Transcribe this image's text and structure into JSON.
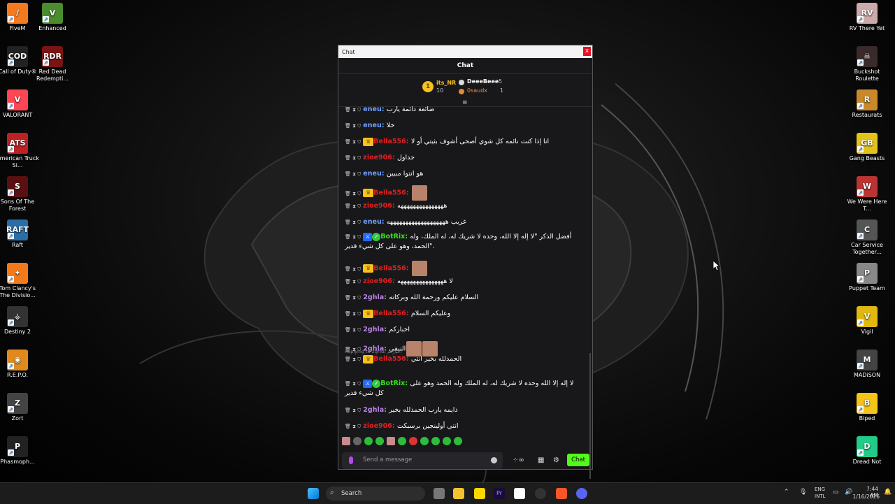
{
  "desktop_left": [
    {
      "label": "FiveM",
      "color": "#f47a20",
      "glyph": "/"
    },
    {
      "label": "Call of Duty®",
      "color": "#222",
      "glyph": "COD"
    },
    {
      "label": "VALORANT",
      "color": "#ff4655",
      "glyph": "V"
    },
    {
      "label": "American Truck Si...",
      "color": "#b22",
      "glyph": "ATS"
    },
    {
      "label": "Sons Of The Forest",
      "color": "#5a1010",
      "glyph": "S"
    },
    {
      "label": "Raft",
      "color": "#2b6ea6",
      "glyph": "RAFT"
    },
    {
      "label": "Tom Clancy's The Divisio...",
      "color": "#f27a1a",
      "glyph": "✦"
    },
    {
      "label": "Destiny 2",
      "color": "#333",
      "glyph": "⚶"
    },
    {
      "label": "R.E.P.O.",
      "color": "#e08a1e",
      "glyph": "◉"
    },
    {
      "label": "Zort",
      "color": "#444",
      "glyph": "Z"
    },
    {
      "label": "Phasmoph...",
      "color": "#222",
      "glyph": "P"
    }
  ],
  "desktop_left2": [
    {
      "label": "Enhanced",
      "color": "#4b8c2e",
      "glyph": "V"
    },
    {
      "label": "Red Dead Redempti...",
      "color": "#7a1414",
      "glyph": "RDR"
    }
  ],
  "desktop_right": [
    {
      "label": "RV There Yet",
      "color": "#caa",
      "glyph": "RV"
    },
    {
      "label": "Buckshot Roulette",
      "color": "#3a2a2a",
      "glyph": "☠"
    },
    {
      "label": "Restaurats",
      "color": "#c9892a",
      "glyph": "R"
    },
    {
      "label": "Gang Beasts",
      "color": "#e3c21a",
      "glyph": "GB"
    },
    {
      "label": "We Were Here T...",
      "color": "#b33",
      "glyph": "W"
    },
    {
      "label": "Car Service Together...",
      "color": "#555",
      "glyph": "C"
    },
    {
      "label": "Puppet Team",
      "color": "#888",
      "glyph": "P"
    },
    {
      "label": "Vigil",
      "color": "#e0b80f",
      "glyph": "V"
    },
    {
      "label": "MADiSON",
      "color": "#444",
      "glyph": "M"
    },
    {
      "label": "Biped",
      "color": "#f4c518",
      "glyph": "B"
    },
    {
      "label": "Dread Not",
      "color": "#2c8",
      "glyph": "D"
    }
  ],
  "chat_window": {
    "title": "Chat",
    "close": "x",
    "header": "Chat",
    "leaderboard": {
      "rank": "1",
      "first": {
        "name": "its_NR",
        "count": "10"
      },
      "second": {
        "name": "DeeeBeee",
        "count": "5"
      },
      "third": {
        "name": "0saudx",
        "count": "1"
      }
    },
    "messages": [
      {
        "tools": "🗑 ⧗ ⛉",
        "user": "eneu",
        "color": "blue",
        "text": "ضائعة دائمة يارب",
        "badges": ""
      },
      {
        "tools": "🗑 ⧗ ⛉",
        "user": "eneu",
        "color": "blue",
        "text": "خلا",
        "badges": ""
      },
      {
        "tools": "🗑 ⧗ ⛉",
        "user": "Bella556",
        "color": "red",
        "text": "انا إذا كنت نائمه كل شوي أصحى أشوف بثيتي أو لا",
        "badges": "crown"
      },
      {
        "tools": "🗑 ⧗ ⛉",
        "user": "zioe906",
        "color": "red",
        "text": "جداول",
        "badges": ""
      },
      {
        "tools": "🗑 ⧗ ⛉",
        "user": "eneu",
        "color": "blue",
        "text": "هو انتوا مبيين",
        "badges": ""
      },
      {
        "tools": "🗑 ⧗ ⛉",
        "user": "Bella556",
        "color": "red",
        "text": "",
        "badges": "crown",
        "emote": "1"
      },
      {
        "tools": "🗑 ⧗ ⛉",
        "user": "zioe906",
        "color": "red",
        "text": "هههههههههههههههه",
        "badges": ""
      },
      {
        "tools": "🗑 ⧗ ⛉",
        "user": "eneu",
        "color": "blue",
        "text": "غريب هههههههههههههههههههه",
        "badges": ""
      },
      {
        "tools": "🗑 ⧗ ⛉",
        "user": "BotRix",
        "color": "green",
        "text": "أفضل الذكر \"لا إله إلا الله، وحده لا شريك له، له الملك، وله الحمد، وهو على كل شيء قدير\".",
        "badges": "mod"
      },
      {
        "tools": "🗑 ⧗ ⛉",
        "user": "Bella556",
        "color": "red",
        "text": "",
        "badges": "crown",
        "emote": "1"
      },
      {
        "tools": "🗑 ⧗ ⛉",
        "user": "zioe906",
        "color": "red",
        "text": "لا هههههههههههههههه",
        "badges": ""
      },
      {
        "tools": "🗑 ⧗ ⛉",
        "user": "2ghla",
        "color": "purple",
        "text": "السلام عليكم ورحمة الله وبركاته",
        "badges": ""
      },
      {
        "tools": "🗑 ⧗ ⛉",
        "user": "Bella556",
        "color": "red",
        "text": "وعليكم السلام",
        "badges": "crown"
      },
      {
        "tools": "🗑 ⧗ ⛉",
        "user": "2ghla",
        "color": "purple",
        "text": "اخباركم",
        "badges": ""
      },
      {
        "tools": "🗑 ⧗ ⛉",
        "user": "2ghla",
        "color": "purple",
        "text": "النبقى",
        "badges": "",
        "emote": "2"
      },
      {
        "tools": "🗑 ⧗ ⛉",
        "user": "Bella556",
        "color": "red",
        "text": "الحمدلله بخير انتي",
        "badges": "crown",
        "reply": "Replying to 2ghla: اخباركم"
      },
      {
        "tools": "🗑 ⧗ ⛉",
        "user": "BotRix",
        "color": "green",
        "text": "لا إله إلا الله وحده لا شريك له، له الملك وله الحمد وهو على كل شيء قدير",
        "badges": "mod"
      },
      {
        "tools": "🗑 ⧗ ⛉",
        "user": "2ghla",
        "color": "purple",
        "text": "دايمه يارب الحمدلله بخير",
        "badges": ""
      },
      {
        "tools": "🗑 ⧗ ⛉",
        "user": "zioe906",
        "color": "red",
        "text": "انتي أولينجين برسبكت",
        "badges": ""
      }
    ],
    "input_placeholder": "Send a message",
    "chat_button": "Chat"
  },
  "taskbar": {
    "search_placeholder": "Search",
    "lang": "ENG",
    "lang2": "INTL",
    "time": "7:44 AM",
    "date": "1/16/2026"
  }
}
